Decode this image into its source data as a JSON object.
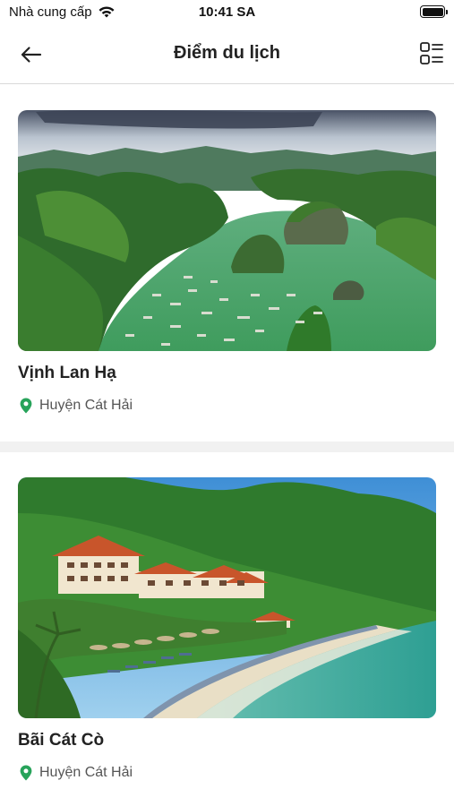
{
  "status_bar": {
    "carrier": "Nhà cung cấp",
    "time": "10:41 SA"
  },
  "nav": {
    "title": "Điểm du lịch",
    "back_icon": "arrow-left-icon",
    "view_toggle_icon": "list-grid-icon"
  },
  "places": [
    {
      "name": "Vịnh Lan Hạ",
      "location": "Huyện Cát Hải",
      "location_icon": "map-pin-icon"
    },
    {
      "name": "Bãi Cát Cò",
      "location": "Huyện Cát Hải",
      "location_icon": "map-pin-icon"
    }
  ],
  "colors": {
    "pin": "#27a35a",
    "separator": "#f1f1f1",
    "title_text": "#222222"
  }
}
